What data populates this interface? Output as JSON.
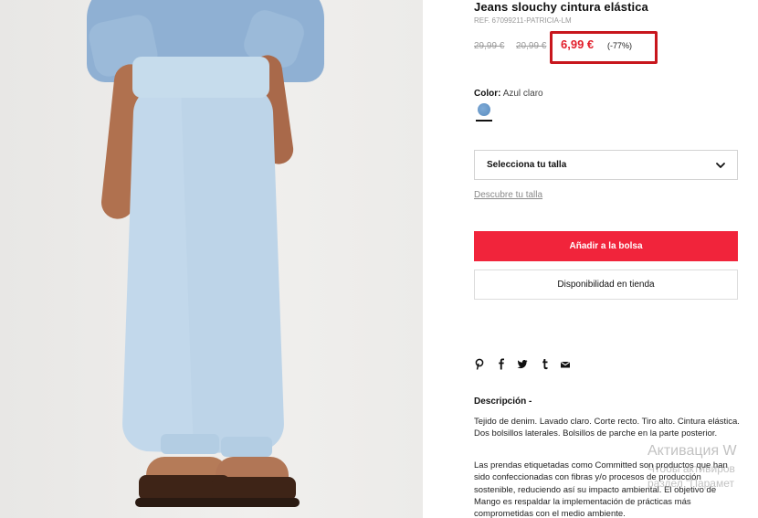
{
  "product": {
    "title": "Jeans slouchy cintura elástica",
    "ref": "REF. 67099211-PATRICIA-LM",
    "old_price_1": "29,99 €",
    "old_price_2": "20,99 €",
    "current_price": "6,99 €",
    "discount": "(-77%)",
    "color_label": "Color:",
    "color_value": "Azul claro",
    "swatch_color": "#6a99cc"
  },
  "size": {
    "placeholder": "Selecciona tu talla",
    "guide_link": "Descubre tu talla"
  },
  "actions": {
    "add_to_bag": "Añadir a la bolsa",
    "store_availability": "Disponibilidad en tienda"
  },
  "share": {
    "icons": [
      "pinterest-icon",
      "facebook-icon",
      "twitter-icon",
      "tumblr-icon",
      "mail-icon"
    ]
  },
  "description": {
    "title": "Descripción -",
    "paragraph_1": "Tejido de denim. Lavado claro. Corte recto. Tiro alto. Cintura elástica. Dos bolsillos laterales. Bolsillos de parche en la parte posterior.",
    "paragraph_2": "Las prendas etiquetadas como Committed son productos que han sido confeccionadas con fibras y/o procesos de producción sostenible, reduciendo así su impacto ambiental. El objetivo de Mango es respaldar la implementación de prácticas más comprometidas con el medio ambiente."
  },
  "watermark": {
    "line_1": "Активация W",
    "line_2": "Чтобы активиров",
    "line_3": "раздел \"Парамет"
  },
  "colors": {
    "accent_red": "#f1243b",
    "price_red": "#e2202c",
    "highlight_box": "#c8161d"
  }
}
